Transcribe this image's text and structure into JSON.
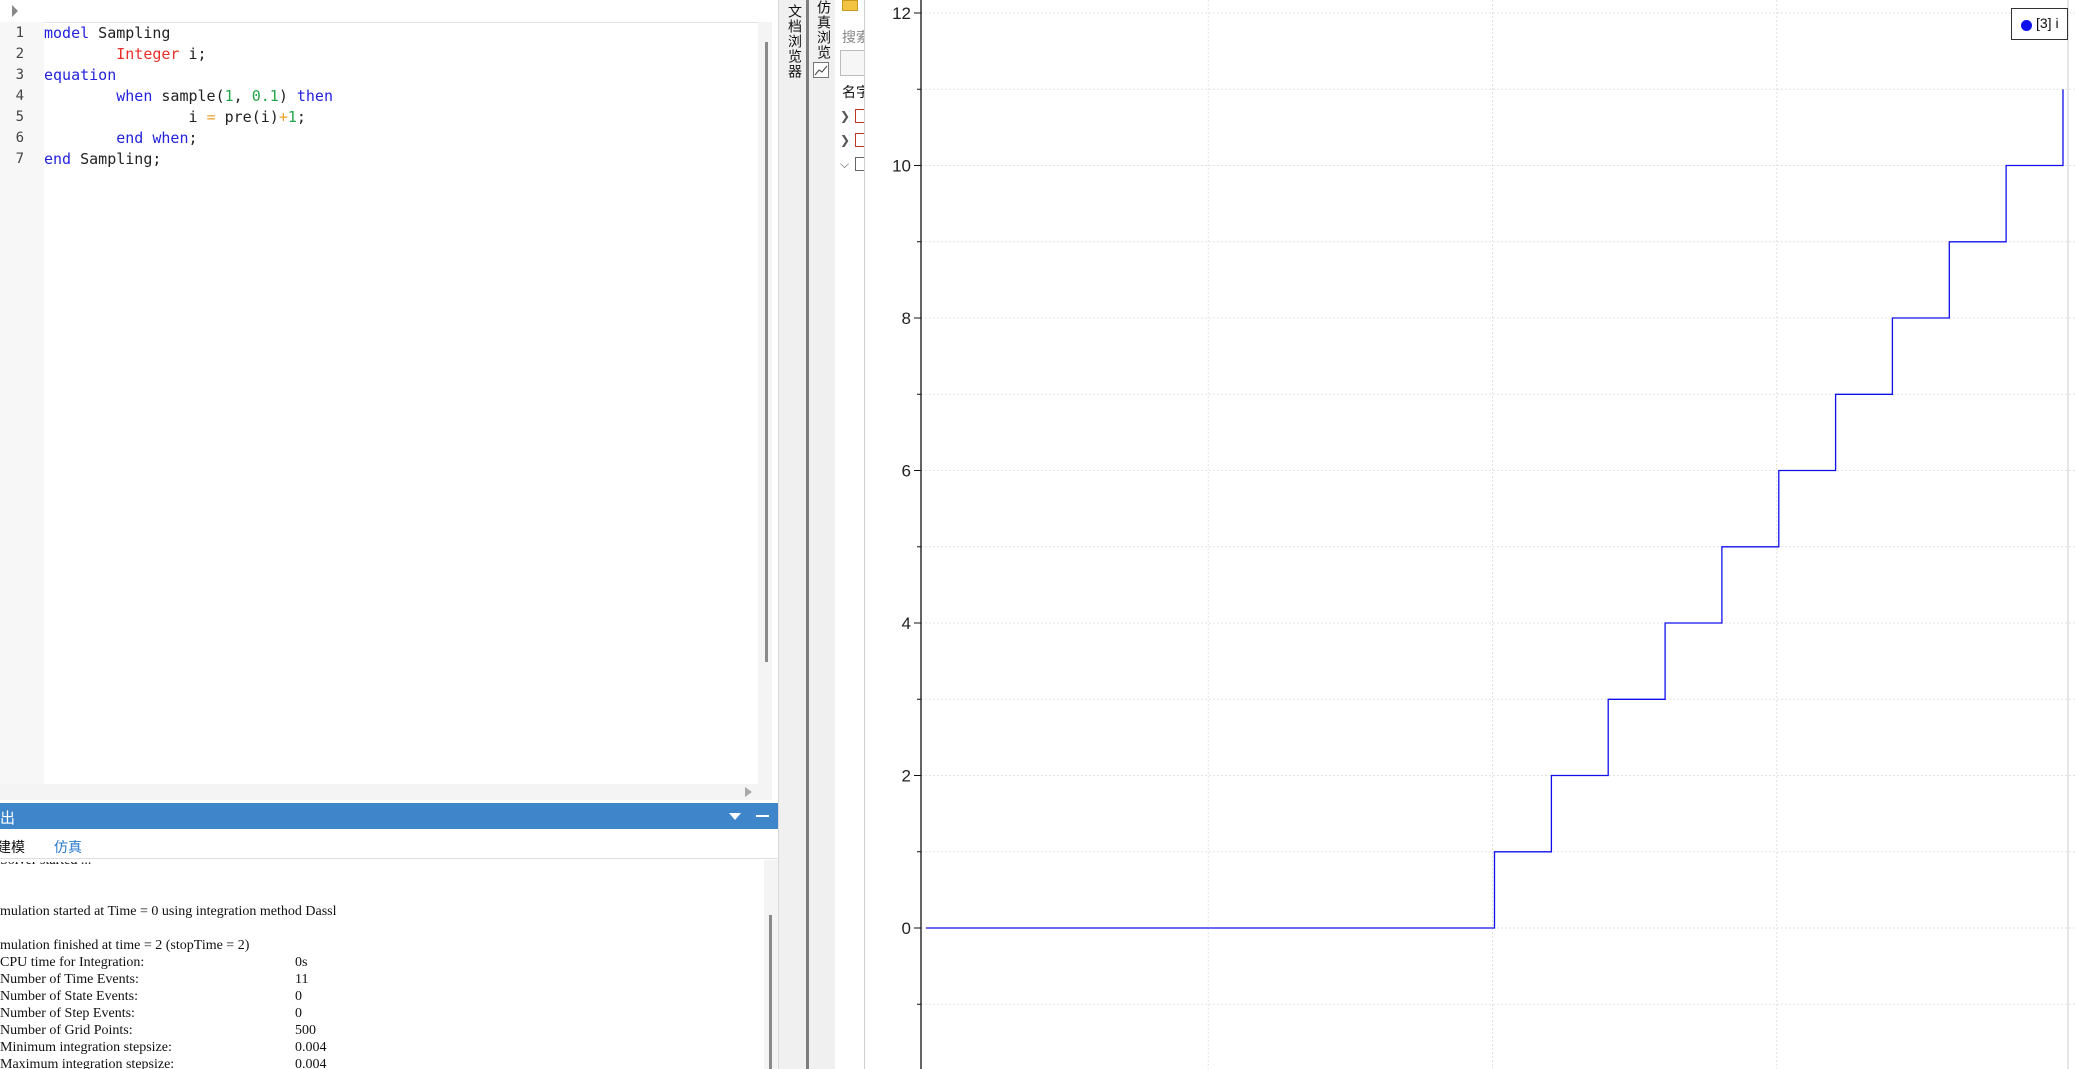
{
  "editor": {
    "line_numbers": [
      "1",
      "2",
      "3",
      "4",
      "5",
      "6",
      "7"
    ],
    "lines": [
      [
        {
          "t": "model",
          "c": "kw"
        },
        {
          "t": " Sampling",
          "c": ""
        }
      ],
      [
        {
          "t": "        ",
          "c": ""
        },
        {
          "t": "Integer",
          "c": "ty"
        },
        {
          "t": " i;",
          "c": ""
        }
      ],
      [
        {
          "t": "equation",
          "c": "kw"
        }
      ],
      [
        {
          "t": "        ",
          "c": ""
        },
        {
          "t": "when",
          "c": "kw"
        },
        {
          "t": " sample(",
          "c": ""
        },
        {
          "t": "1",
          "c": "num"
        },
        {
          "t": ", ",
          "c": ""
        },
        {
          "t": "0.1",
          "c": "num"
        },
        {
          "t": ") ",
          "c": ""
        },
        {
          "t": "then",
          "c": "kw"
        }
      ],
      [
        {
          "t": "                i ",
          "c": ""
        },
        {
          "t": "=",
          "c": "op"
        },
        {
          "t": " pre(i)",
          "c": ""
        },
        {
          "t": "+",
          "c": "op"
        },
        {
          "t": "1",
          "c": "num"
        },
        {
          "t": ";",
          "c": ""
        }
      ],
      [
        {
          "t": "        ",
          "c": ""
        },
        {
          "t": "end when",
          "c": "kw"
        },
        {
          "t": ";",
          "c": ""
        }
      ],
      [
        {
          "t": "end",
          "c": "kw"
        },
        {
          "t": " Sampling;",
          "c": ""
        }
      ]
    ]
  },
  "output_panel": {
    "title": "出",
    "tabs": [
      {
        "label": "建模"
      },
      {
        "label": "仿真"
      }
    ],
    "log": [
      {
        "text": "Solver started ...",
        "value": ""
      },
      {
        "text": "",
        "value": ""
      },
      {
        "text": "",
        "value": ""
      },
      {
        "text": "mulation started at Time = 0 using integration method Dassl",
        "value": ""
      },
      {
        "text": "",
        "value": ""
      },
      {
        "text": "mulation finished at time = 2 (stopTime = 2)",
        "value": ""
      },
      {
        "text": "CPU time for Integration:",
        "value": "0s"
      },
      {
        "text": "Number of Time Events:",
        "value": "11"
      },
      {
        "text": "Number of State Events:",
        "value": "0"
      },
      {
        "text": "Number of Step Events:",
        "value": "0"
      },
      {
        "text": "Number of Grid Points:",
        "value": "500"
      },
      {
        "text": "Minimum integration stepsize:",
        "value": "0.004"
      },
      {
        "text": "Maximum integration stepsize:",
        "value": "0.004"
      }
    ]
  },
  "side_tabs": {
    "document_browser": "文档浏览器",
    "simulation_browser": "仿真浏览"
  },
  "sim_browser": {
    "search_label": "搜索",
    "column_name": "名字"
  },
  "colors": {
    "keyword": "#2222dd",
    "type": "#e8302a",
    "number": "#23a64a",
    "operator": "#e8a128",
    "panel_title_bg": "#3e86c9",
    "series": "#1010ee"
  },
  "chart_data": {
    "type": "line",
    "title": "",
    "xlabel": "",
    "ylabel": "",
    "ylim": [
      -1.8,
      12.2
    ],
    "xlim": [
      0,
      2
    ],
    "ytick_labels": [
      "0",
      "2",
      "4",
      "6",
      "8",
      "10",
      "12"
    ],
    "ytick_values": [
      0,
      2,
      4,
      6,
      8,
      10,
      12
    ],
    "grid": true,
    "legend_position": "top-right",
    "series": [
      {
        "name": "[3] i",
        "x": [
          0,
          1,
          1,
          1.1,
          1.1,
          1.2,
          1.2,
          1.3,
          1.3,
          1.4,
          1.4,
          1.5,
          1.5,
          1.6,
          1.6,
          1.7,
          1.7,
          1.8,
          1.8,
          1.9,
          1.9,
          2.0,
          2.0
        ],
        "y": [
          0,
          0,
          1,
          1,
          2,
          2,
          3,
          3,
          4,
          4,
          5,
          5,
          6,
          6,
          7,
          7,
          8,
          8,
          9,
          9,
          10,
          10,
          11
        ]
      }
    ]
  }
}
